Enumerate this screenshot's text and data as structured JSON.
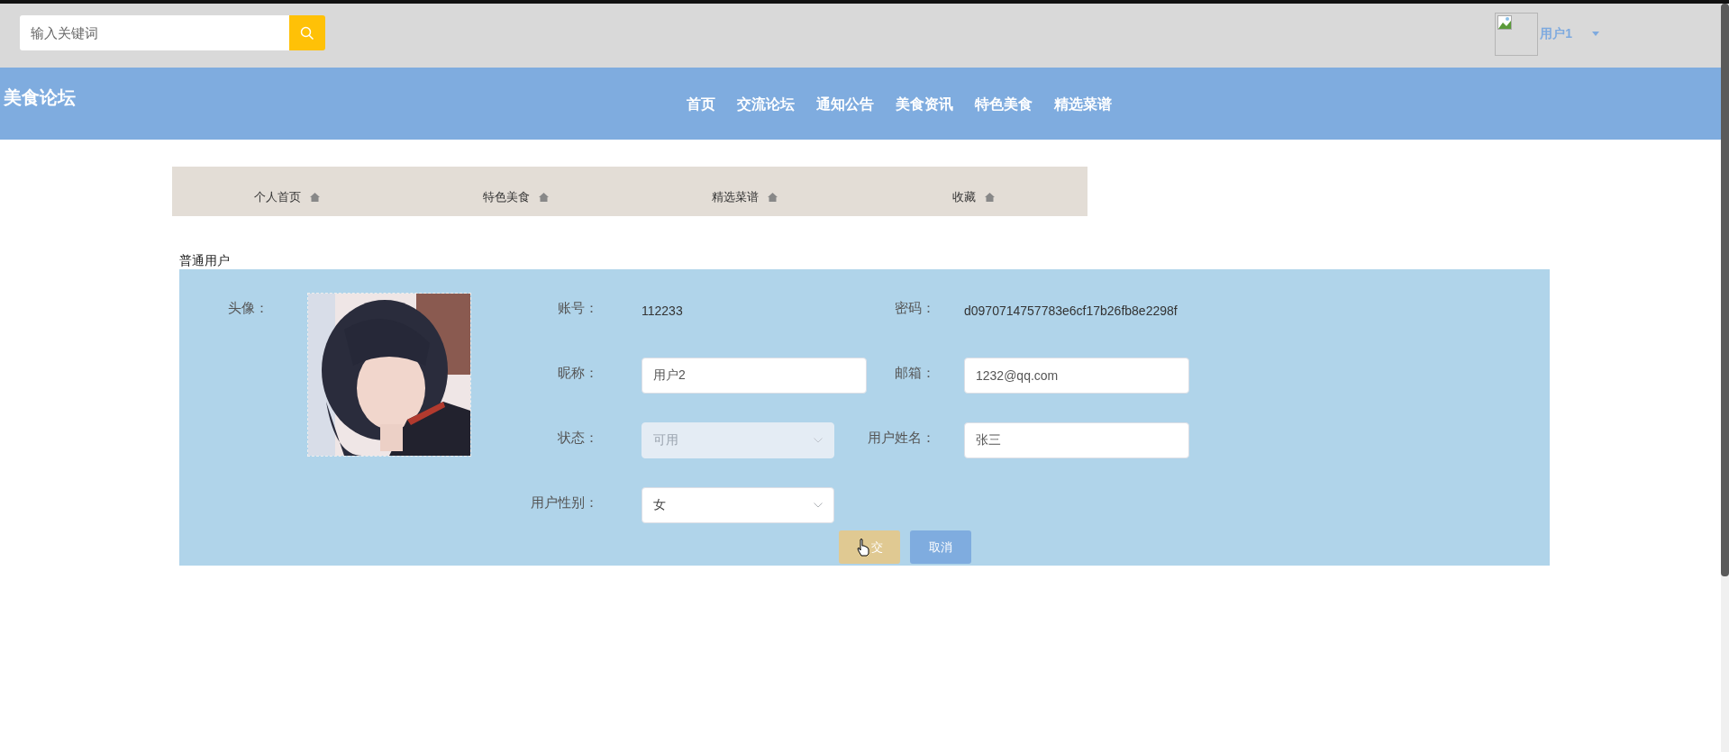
{
  "search": {
    "placeholder": "输入关键词"
  },
  "user_menu": {
    "username": "用户1"
  },
  "site_title": "美食论坛",
  "nav": [
    {
      "label": "首页"
    },
    {
      "label": "交流论坛"
    },
    {
      "label": "通知公告"
    },
    {
      "label": "美食资讯"
    },
    {
      "label": "特色美食"
    },
    {
      "label": "精选菜谱"
    }
  ],
  "tabs": [
    {
      "label": "个人首页"
    },
    {
      "label": "特色美食"
    },
    {
      "label": "精选菜谱"
    },
    {
      "label": "收藏"
    }
  ],
  "section_title": "普通用户",
  "avatar": {
    "label": "头像：",
    "kind": "picture"
  },
  "fields": [
    {
      "label": "账号：",
      "kind": "text",
      "value": "112233"
    },
    {
      "label": "密码：",
      "kind": "text",
      "value": "d0970714757783e6cf17b26fb8e2298f"
    },
    {
      "label": "昵称：",
      "kind": "input",
      "value": "用户2"
    },
    {
      "label": "邮箱：",
      "kind": "input",
      "value": "1232@qq.com"
    },
    {
      "label": "状态：",
      "kind": "select",
      "value": "可用",
      "disabled": true
    },
    {
      "label": "用户姓名：",
      "kind": "input",
      "value": "张三"
    },
    {
      "label": "用户性别：",
      "kind": "select",
      "value": "女",
      "disabled": false
    }
  ],
  "buttons": [
    {
      "label": "交",
      "kind": "submit"
    },
    {
      "label": "取消",
      "kind": "cancel"
    }
  ]
}
